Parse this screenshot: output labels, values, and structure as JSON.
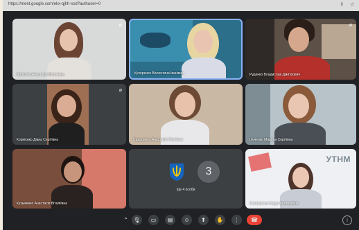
{
  "browser": {
    "url": "https://meet.google.com/ekx-qjhh-xsd?authuser=0"
  },
  "tiles": [
    {
      "id": "p1",
      "name": "Лопатіна Анастасія Євгенівна"
    },
    {
      "id": "p2",
      "name": "Кучеренко Валентина Іванівна"
    },
    {
      "id": "p3",
      "name": "Руденко Владислав Дмитрович"
    },
    {
      "id": "p4",
      "name": "Корнієнко Діана Сергіївна"
    },
    {
      "id": "p5",
      "name": "Сидоренко Анастасія Олегівна"
    },
    {
      "id": "p6",
      "name": "Ільченко Марина Сергіївна"
    },
    {
      "id": "p7",
      "name": "Кузьменко Анастасія Віталіївна"
    },
    {
      "id": "p8",
      "others_count": "3",
      "others_label": "Ще 4 особи"
    },
    {
      "id": "p9",
      "name": "Степаненко Надія Анатоліївна",
      "logo": "УТНМ"
    }
  ],
  "toolbar": {
    "buttons": [
      "mic-icon",
      "camera-icon",
      "captions-icon",
      "emoji-icon",
      "present-icon",
      "raise-hand-icon",
      "more-icon",
      "end-call-icon"
    ],
    "glyphs": {
      "chevron": "⌃",
      "mic": "🎙",
      "cam": "▭",
      "cc": "▤",
      "emoji": "☺",
      "present": "⬆",
      "hand": "✋",
      "more": "⋮",
      "end": "☎",
      "info": "i"
    }
  },
  "colors": {
    "end_call": "#ea4335",
    "tile_bg": "#3c4043",
    "meet_bg": "#202124"
  }
}
